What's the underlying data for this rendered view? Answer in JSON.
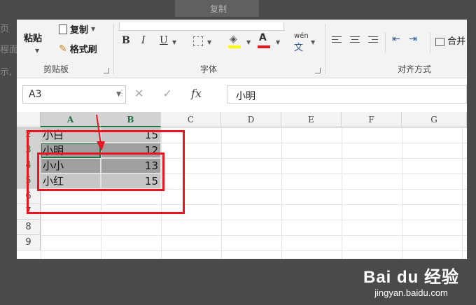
{
  "background_text": [
    "页",
    "程面",
    "示,"
  ],
  "ribbon": {
    "clipboard": {
      "paste_label": "粘贴",
      "copy_label": "复制",
      "format_painter_label": "格式刷",
      "group_label": "剪贴板"
    },
    "font": {
      "bold": "B",
      "italic": "I",
      "underline": "U",
      "phonetic": "wén",
      "group_label": "字体"
    },
    "alignment": {
      "merge_label": "合并",
      "group_label": "对齐方式"
    },
    "top_strip_label": "复制"
  },
  "formula_bar": {
    "name_box": "A3",
    "cancel": "✕",
    "enter": "✓",
    "function": "fx",
    "value": "小明"
  },
  "grid": {
    "columns": [
      "A",
      "B",
      "C",
      "D",
      "E",
      "F",
      "G"
    ],
    "rows": [
      "2",
      "3",
      "4",
      "5",
      "6",
      "7",
      "8",
      "9"
    ],
    "cells": [
      {
        "row": "2",
        "name": "小白",
        "value": "15"
      },
      {
        "row": "3",
        "name": "小明",
        "value": "12"
      },
      {
        "row": "4",
        "name": "小小",
        "value": "13"
      },
      {
        "row": "5",
        "name": "小红",
        "value": "15"
      }
    ]
  },
  "watermark": {
    "logo": "Bai du 经验",
    "url": "jingyan.baidu.com"
  },
  "colors": {
    "excel_green": "#217346",
    "annotation_red": "#e8141e",
    "selection_gray": "#9f9f9f"
  }
}
